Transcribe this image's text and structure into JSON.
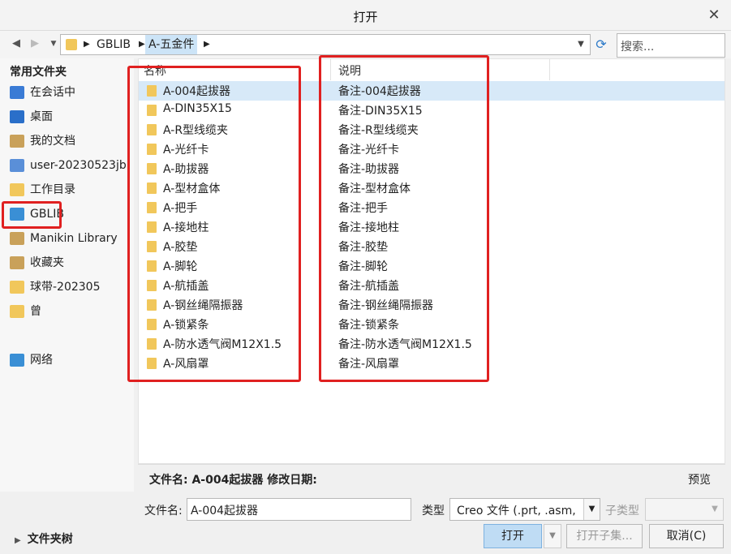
{
  "window": {
    "title": "打开",
    "close_glyph": "✕"
  },
  "toolbar": {
    "back_glyph": "◀",
    "forward_glyph": "▶",
    "dropdown_glyph": "▼",
    "path": [
      "GBLIB",
      "A-五金件"
    ],
    "search_placeholder": "搜索...",
    "refresh_glyph": "⟳"
  },
  "sidebar": {
    "header": "常用文件夹",
    "items": [
      {
        "label": "在会话中",
        "icon": "monitor-icon",
        "color": "#3a7bd5"
      },
      {
        "label": "桌面",
        "icon": "desktop-icon",
        "color": "#2a6fc9"
      },
      {
        "label": "我的文档",
        "icon": "documents-icon",
        "color": "#c9a15a"
      },
      {
        "label": "user-20230523jb",
        "icon": "computer-icon",
        "color": "#5a8fd8"
      },
      {
        "label": "工作目录",
        "icon": "workdir-icon",
        "color": "#f1c75b"
      },
      {
        "label": "GBLIB",
        "icon": "library-icon",
        "color": "#3a8fd5"
      },
      {
        "label": "Manikin Library",
        "icon": "manikin-library-icon",
        "color": "#c9a15a"
      },
      {
        "label": "收藏夹",
        "icon": "favorites-icon",
        "color": "#c9a15a"
      },
      {
        "label": "球带-202305",
        "icon": "folder-icon",
        "color": "#f1c75b"
      },
      {
        "label": "曾",
        "icon": "folder-icon",
        "color": "#f1c75b"
      },
      {
        "label": "网络",
        "icon": "network-icon",
        "color": "#3a8fd5"
      }
    ]
  },
  "file_list": {
    "columns": {
      "name": "名称",
      "desc": "说明"
    },
    "rows": [
      {
        "name": "A-004起拔器",
        "desc": "备注-004起拔器"
      },
      {
        "name": "A-DIN35X15",
        "desc": "备注-DIN35X15"
      },
      {
        "name": "A-R型线缆夹",
        "desc": "备注-R型线缆夹"
      },
      {
        "name": "A-光纤卡",
        "desc": "备注-光纤卡"
      },
      {
        "name": "A-助拔器",
        "desc": "备注-助拔器"
      },
      {
        "name": "A-型材盒体",
        "desc": "备注-型材盒体"
      },
      {
        "name": "A-把手",
        "desc": "备注-把手"
      },
      {
        "name": "A-接地柱",
        "desc": "备注-接地柱"
      },
      {
        "name": "A-胶垫",
        "desc": "备注-胶垫"
      },
      {
        "name": "A-脚轮",
        "desc": "备注-脚轮"
      },
      {
        "name": "A-航插盖",
        "desc": "备注-航插盖"
      },
      {
        "name": "A-钢丝绳隔振器",
        "desc": "备注-钢丝绳隔振器"
      },
      {
        "name": "A-锁紧条",
        "desc": "备注-锁紧条"
      },
      {
        "name": "A-防水透气阀M12X1.5",
        "desc": "备注-防水透气阀M12X1.5"
      },
      {
        "name": "A-风扇罩",
        "desc": "备注-风扇罩"
      }
    ]
  },
  "info": {
    "text": "文件名: A-004起拔器  修改日期:",
    "preview": "预览"
  },
  "bottom": {
    "filename_label": "文件名:",
    "filename_value": "A-004起拔器",
    "type_label": "类型",
    "type_value": "Creo 文件 (.prt, .asm,",
    "subtype_label": "子类型",
    "open_button": "打开",
    "open_subset_button": "打开子集...",
    "cancel_button": "取消(C)",
    "folder_tree": "文件夹树"
  },
  "colors": {
    "selection": "#d7e9f8",
    "annotation": "#e02020",
    "folder": "#f1c75b"
  }
}
